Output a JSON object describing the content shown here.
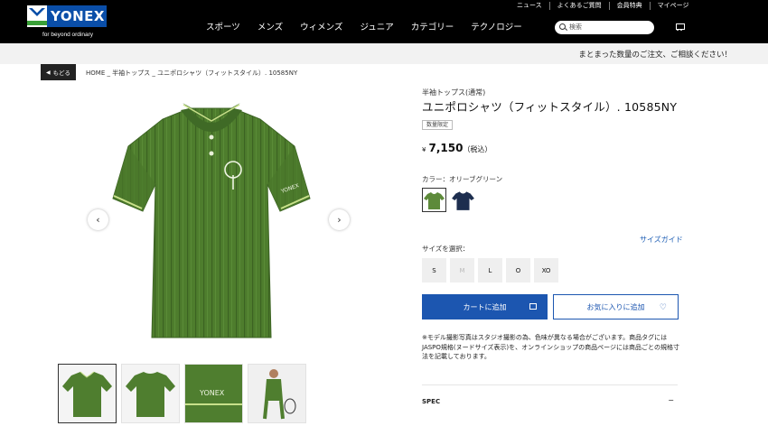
{
  "header": {
    "logo_text": "YONEX",
    "tagline": "for beyond ordinary",
    "nav": [
      "スポーツ",
      "メンズ",
      "ウィメンズ",
      "ジュニア",
      "カテゴリー",
      "テクノロジー"
    ],
    "util_links": [
      "ニュース",
      "よくあるご質問",
      "会員特典",
      "マイページ"
    ],
    "search_placeholder": "検索"
  },
  "banner": {
    "text": "まとまった数量のご注文、ご相談ください！"
  },
  "back_label": "もどる",
  "breadcrumb": "HOME _ 半袖トップス _ ユニポロシャツ（フィットスタイル）. 10585NY",
  "product": {
    "category": "半袖トップス(通常)",
    "title": "ユニポロシャツ（フィットスタイル）. 10585NY",
    "badge": "数量限定",
    "price_symbol": "¥",
    "price": "7,150",
    "tax_note": "（税込）",
    "color_label": "カラー：オリーブグリーン",
    "colors": [
      {
        "name": "olive-green",
        "hex": "#5d8a3a"
      },
      {
        "name": "navy",
        "hex": "#1d2e4f"
      }
    ],
    "size_guide": "サイズガイド",
    "size_label": "サイズを選択：",
    "sizes": [
      {
        "label": "S",
        "available": true
      },
      {
        "label": "M",
        "available": false
      },
      {
        "label": "L",
        "available": true
      },
      {
        "label": "O",
        "available": true
      },
      {
        "label": "XO",
        "available": true
      }
    ],
    "add_to_cart": "カートに追加",
    "add_to_fav": "お気に入りに追加",
    "note": "※モデル撮影写真はスタジオ撮影の為、色味が異なる場合がございます。商品タグにはJASPO規格(ヌードサイズ表示)を、オンラインショップの商品ページには商品ごとの規格寸法を記載しております。",
    "spec_label": "SPEC",
    "spec_toggle": "−"
  },
  "colors": {
    "accent": "#1c56b0",
    "header_bg": "#000000",
    "shirt": "#4f7e2f"
  }
}
